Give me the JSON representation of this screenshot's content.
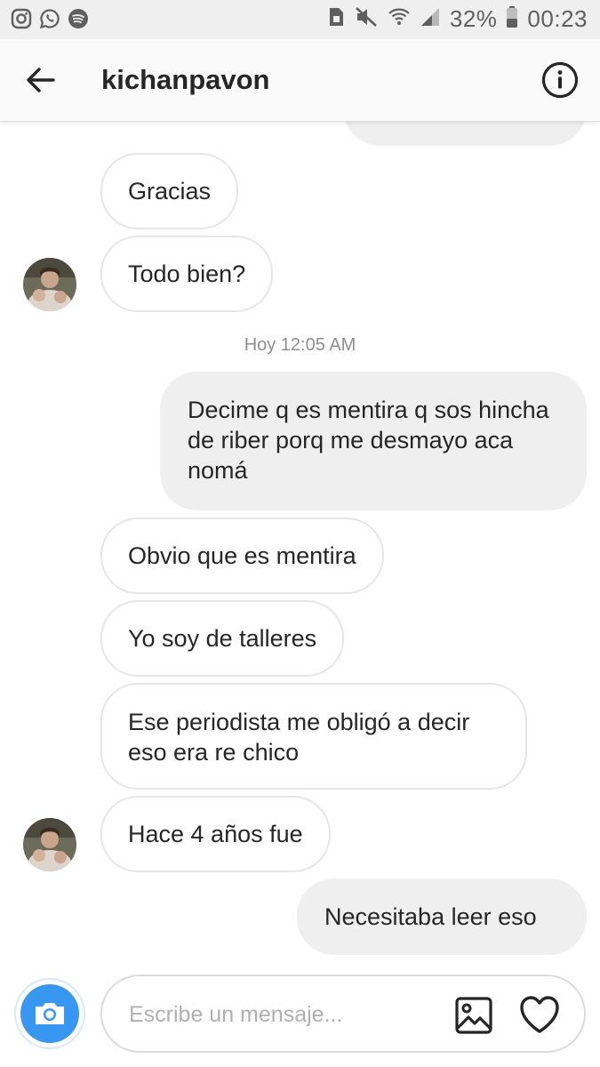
{
  "status_bar": {
    "left_icons": [
      "instagram-icon",
      "whatsapp-icon",
      "spotify-icon"
    ],
    "right_icons": [
      "sim-icon",
      "mute-icon",
      "wifi-icon",
      "signal-icon"
    ],
    "battery": "32%",
    "time": "00:23"
  },
  "header": {
    "title": "kichanpavon",
    "back_icon": "arrow-left-icon",
    "info_icon": "info-circle-icon"
  },
  "messages": [
    {
      "side": "received",
      "text": "Gracias"
    },
    {
      "side": "received",
      "text": "Todo bien?",
      "avatar": true
    },
    {
      "type": "timestamp",
      "text": "Hoy 12:05 AM"
    },
    {
      "side": "sent",
      "text": "Decime q es mentira q sos hincha de riber porq me desmayo aca nomá"
    },
    {
      "side": "received",
      "text": "Obvio que es mentira"
    },
    {
      "side": "received",
      "text": "Yo soy de talleres"
    },
    {
      "side": "received",
      "text": "Ese periodista me obligó a decir eso era re chico"
    },
    {
      "side": "received",
      "text": "Hace 4 años fue",
      "avatar": true
    },
    {
      "side": "sent",
      "text": "Necesitaba leer eso"
    }
  ],
  "composer": {
    "placeholder": "Escribe un mensaje...",
    "camera_icon": "camera-icon",
    "gallery_icon": "image-icon",
    "like_icon": "heart-icon"
  },
  "colors": {
    "accent": "#3897f0",
    "sent_bubble": "#efefef",
    "received_border": "#e6e6e6",
    "text": "#262626",
    "muted": "#8e8e8e"
  }
}
